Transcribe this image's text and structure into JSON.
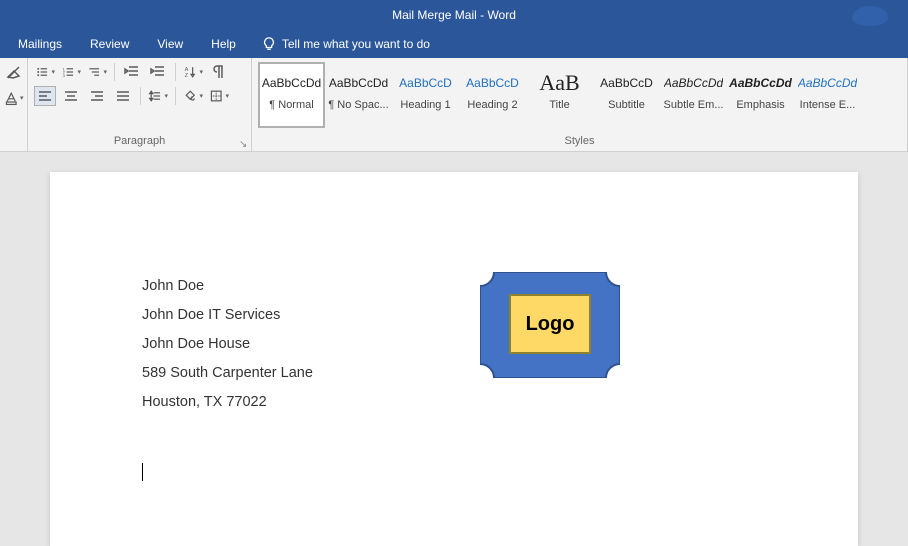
{
  "window": {
    "title": "Mail Merge Mail  -  Word"
  },
  "menu": {
    "tabs": [
      "Mailings",
      "Review",
      "View",
      "Help"
    ],
    "tellme": "Tell me what you want to do"
  },
  "ribbon": {
    "paragraph_label": "Paragraph",
    "styles_label": "Styles",
    "styles": [
      {
        "preview": "AaBbCcDd",
        "label": "¶ Normal",
        "cls": "selected"
      },
      {
        "preview": "AaBbCcDd",
        "label": "¶ No Spac...",
        "cls": ""
      },
      {
        "preview": "AaBbCcD",
        "label": "Heading 1",
        "cls": "link"
      },
      {
        "preview": "AaBbCcD",
        "label": "Heading 2",
        "cls": "link"
      },
      {
        "preview": "AaB",
        "label": "Title",
        "cls": "title"
      },
      {
        "preview": "AaBbCcD",
        "label": "Subtitle",
        "cls": ""
      },
      {
        "preview": "AaBbCcDd",
        "label": "Subtle Em...",
        "cls": "italic"
      },
      {
        "preview": "AaBbCcDd",
        "label": "Emphasis",
        "cls": "italic bold"
      },
      {
        "preview": "AaBbCcDd",
        "label": "Intense E...",
        "cls": "italic link"
      }
    ]
  },
  "document": {
    "lines": [
      "John Doe",
      "John Doe IT Services",
      "John Doe House",
      "589 South Carpenter Lane",
      "Houston, TX 77022"
    ],
    "logo_text": "Logo"
  },
  "colors": {
    "brand": "#2b579a",
    "logo_fill": "#ffd966",
    "shape_fill": "#4472c4"
  }
}
